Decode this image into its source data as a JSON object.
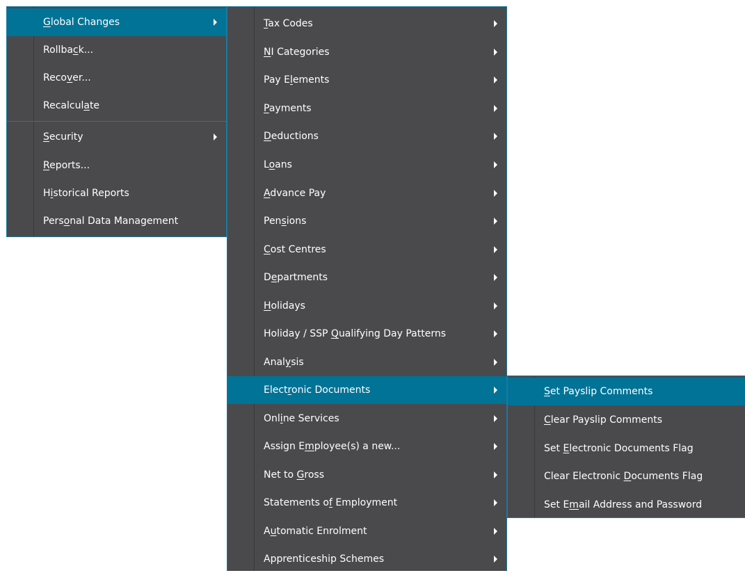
{
  "colors": {
    "menu_background": "#4a4a4c",
    "highlight": "#007396",
    "border": "#1a7aa0",
    "text": "#ffffff"
  },
  "menu1": {
    "items": [
      {
        "label": "Global Changes",
        "pre": "",
        "ul": "G",
        "post": "lobal Changes",
        "submenu": true,
        "highlighted": true
      },
      {
        "label": "Rollback...",
        "pre": "Rollba",
        "ul": "c",
        "post": "k...",
        "submenu": false
      },
      {
        "label": "Recover...",
        "pre": "Reco",
        "ul": "v",
        "post": "er...",
        "submenu": false
      },
      {
        "label": "Recalculate",
        "pre": "Recalcul",
        "ul": "a",
        "post": "te",
        "submenu": false
      },
      {
        "label": "Security",
        "pre": "",
        "ul": "S",
        "post": "ecurity",
        "submenu": true
      },
      {
        "label": "Reports...",
        "pre": "",
        "ul": "R",
        "post": "eports...",
        "submenu": false
      },
      {
        "label": "Historical Reports",
        "pre": "H",
        "ul": "i",
        "post": "storical Reports",
        "submenu": false
      },
      {
        "label": "Personal Data Management",
        "pre": "Pers",
        "ul": "o",
        "post": "nal Data Management",
        "submenu": false
      }
    ]
  },
  "menu2": {
    "items": [
      {
        "label": "Tax Codes",
        "pre": "",
        "ul": "T",
        "post": "ax Codes"
      },
      {
        "label": "NI Categories",
        "pre": "",
        "ul": "N",
        "post": "I Categories"
      },
      {
        "label": "Pay Elements",
        "pre": "Pay E",
        "ul": "l",
        "post": "ements"
      },
      {
        "label": "Payments",
        "pre": "",
        "ul": "P",
        "post": "ayments"
      },
      {
        "label": "Deductions",
        "pre": "",
        "ul": "D",
        "post": "eductions"
      },
      {
        "label": "Loans",
        "pre": "L",
        "ul": "o",
        "post": "ans"
      },
      {
        "label": "Advance Pay",
        "pre": "",
        "ul": "A",
        "post": "dvance Pay"
      },
      {
        "label": "Pensions",
        "pre": "Pen",
        "ul": "s",
        "post": "ions"
      },
      {
        "label": "Cost Centres",
        "pre": "",
        "ul": "C",
        "post": "ost Centres"
      },
      {
        "label": "Departments",
        "pre": "D",
        "ul": "e",
        "post": "partments"
      },
      {
        "label": "Holidays",
        "pre": "",
        "ul": "H",
        "post": "olidays"
      },
      {
        "label": "Holiday / SSP Qualifying Day Patterns",
        "pre": "Holiday / SSP ",
        "ul": "Q",
        "post": "ualifying Day Patterns"
      },
      {
        "label": "Analysis",
        "pre": "Anal",
        "ul": "y",
        "post": "sis"
      },
      {
        "label": "Electronic Documents",
        "pre": "Elect",
        "ul": "r",
        "post": "onic Documents",
        "highlighted": true
      },
      {
        "label": "Online Services",
        "pre": "Onl",
        "ul": "i",
        "post": "ne Services"
      },
      {
        "label": "Assign Employee(s) a new...",
        "pre": "Assign E",
        "ul": "m",
        "post": "ployee(s) a new..."
      },
      {
        "label": "Net to Gross",
        "pre": "Net to ",
        "ul": "G",
        "post": "ross"
      },
      {
        "label": "Statements of Employment",
        "pre": "Statements o",
        "ul": "f",
        "post": " Employment"
      },
      {
        "label": "Automatic Enrolment",
        "pre": "A",
        "ul": "u",
        "post": "tomatic Enrolment"
      },
      {
        "label": "Apprenticeship Schemes",
        "pre": "Apprenticeship Schemes",
        "ul": "",
        "post": ""
      }
    ]
  },
  "menu3": {
    "items": [
      {
        "label": "Set Payslip Comments",
        "pre": "",
        "ul": "S",
        "post": "et Payslip Comments",
        "highlighted": true
      },
      {
        "label": "Clear Payslip Comments",
        "pre": "",
        "ul": "C",
        "post": "lear Payslip Comments"
      },
      {
        "label": "Set Electronic Documents Flag",
        "pre": "Set ",
        "ul": "E",
        "post": "lectronic Documents Flag"
      },
      {
        "label": "Clear Electronic Documents Flag",
        "pre": "Clear Electronic ",
        "ul": "D",
        "post": "ocuments Flag"
      },
      {
        "label": "Set Email Address and Password",
        "pre": "Set E",
        "ul": "m",
        "post": "ail Address and Password"
      }
    ]
  }
}
